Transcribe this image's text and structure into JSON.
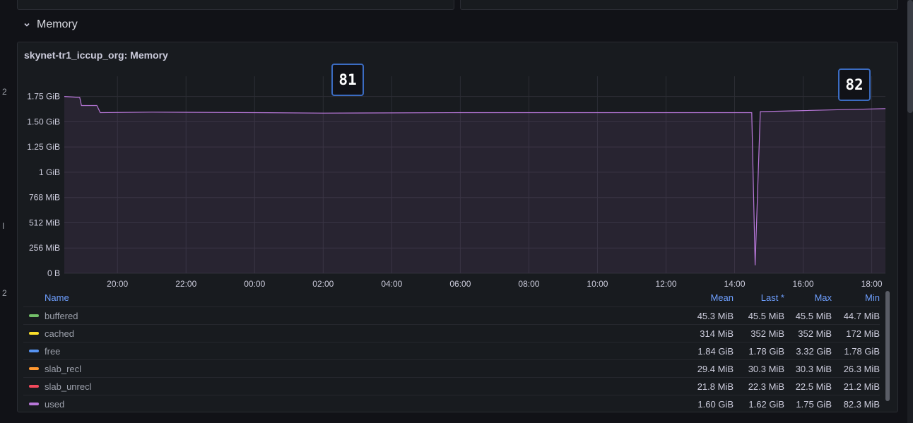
{
  "row": {
    "title": "Memory",
    "icon": "chevron-down-icon"
  },
  "panel": {
    "title": "skynet-tr1_iccup_org: Memory"
  },
  "badges": [
    "81",
    "82"
  ],
  "edge_marks": [
    "2",
    "I",
    "2"
  ],
  "chart_data": {
    "type": "area",
    "title": "skynet-tr1_iccup_org: Memory",
    "y_ticks": [
      "0 B",
      "256 MiB",
      "512 MiB",
      "768 MiB",
      "1 GiB",
      "1.25 GiB",
      "1.50 GiB",
      "1.75 GiB"
    ],
    "y_values_gib": [
      0,
      0.25,
      0.5,
      0.75,
      1,
      1.25,
      1.5,
      1.75
    ],
    "ylim_gib": [
      0,
      1.95
    ],
    "x_ticks": [
      "20:00",
      "22:00",
      "00:00",
      "02:00",
      "04:00",
      "06:00",
      "08:00",
      "10:00",
      "12:00",
      "14:00",
      "16:00",
      "18:00"
    ],
    "x_range_hours": [
      18.45,
      42.4
    ],
    "grid": true,
    "series": [
      {
        "name": "used",
        "color": "#b877d9",
        "points_hours_gib": [
          [
            18.45,
            1.75
          ],
          [
            18.9,
            1.74
          ],
          [
            18.95,
            1.66
          ],
          [
            19.4,
            1.66
          ],
          [
            19.5,
            1.59
          ],
          [
            21.0,
            1.595
          ],
          [
            24.0,
            1.59
          ],
          [
            26.0,
            1.585
          ],
          [
            30.0,
            1.59
          ],
          [
            34.0,
            1.59
          ],
          [
            38.5,
            1.59
          ],
          [
            38.6,
            0.08
          ],
          [
            38.75,
            1.6
          ],
          [
            40.0,
            1.61
          ],
          [
            42.4,
            1.63
          ]
        ]
      }
    ]
  },
  "legend": {
    "headers": {
      "name": "Name",
      "mean": "Mean",
      "last": "Last *",
      "max": "Max",
      "min": "Min"
    },
    "rows": [
      {
        "name": "buffered",
        "color": "#73bf69",
        "mean": "45.3 MiB",
        "last": "45.5 MiB",
        "max": "45.5 MiB",
        "min": "44.7 MiB"
      },
      {
        "name": "cached",
        "color": "#fade2a",
        "mean": "314 MiB",
        "last": "352 MiB",
        "max": "352 MiB",
        "min": "172 MiB"
      },
      {
        "name": "free",
        "color": "#5794f2",
        "mean": "1.84 GiB",
        "last": "1.78 GiB",
        "max": "3.32 GiB",
        "min": "1.78 GiB"
      },
      {
        "name": "slab_recl",
        "color": "#ff9830",
        "mean": "29.4 MiB",
        "last": "30.3 MiB",
        "max": "30.3 MiB",
        "min": "26.3 MiB"
      },
      {
        "name": "slab_unrecl",
        "color": "#f2495c",
        "mean": "21.8 MiB",
        "last": "22.3 MiB",
        "max": "22.5 MiB",
        "min": "21.2 MiB"
      },
      {
        "name": "used",
        "color": "#b877d9",
        "mean": "1.60 GiB",
        "last": "1.62 GiB",
        "max": "1.75 GiB",
        "min": "82.3 MiB"
      }
    ]
  }
}
